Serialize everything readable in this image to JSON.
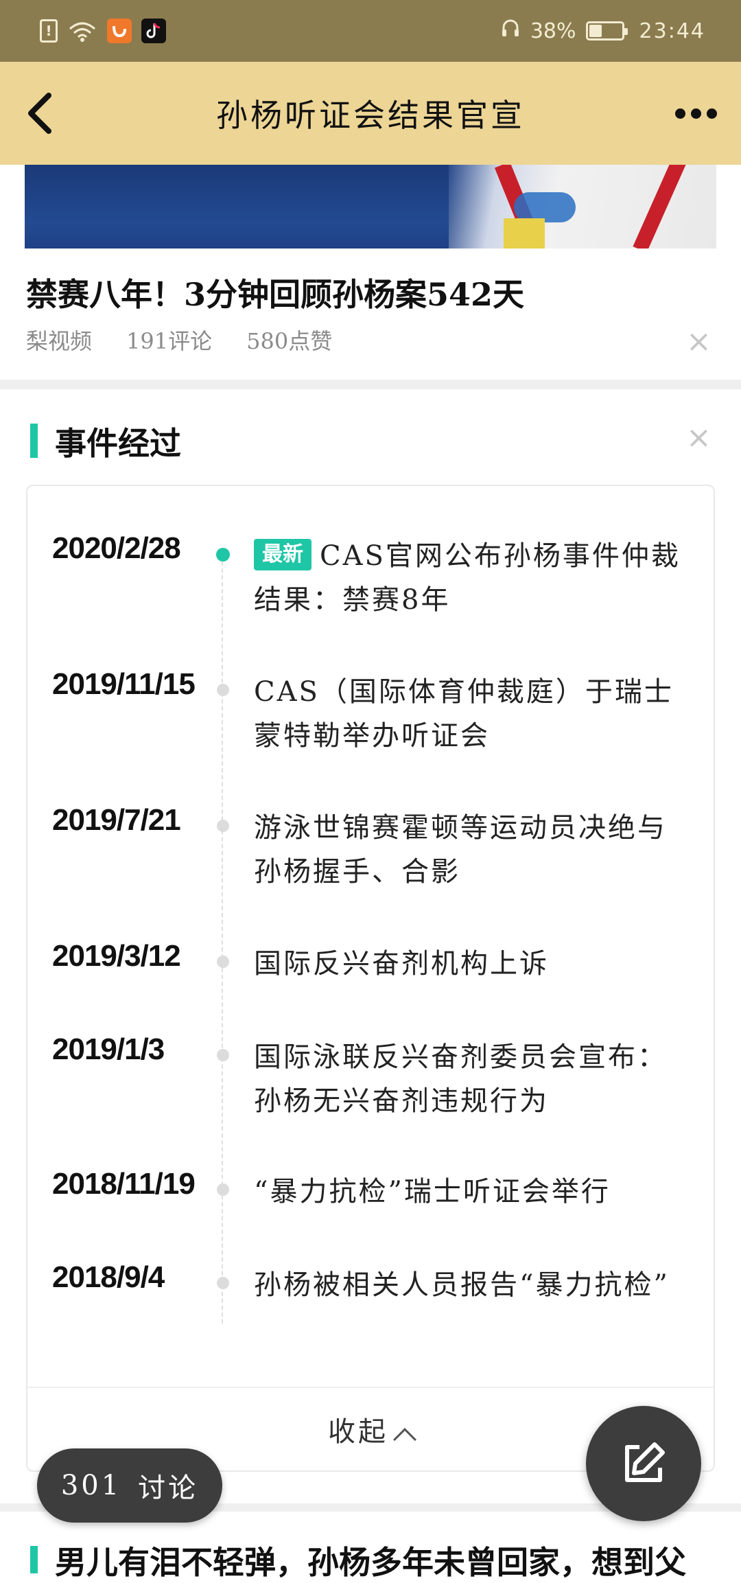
{
  "status_bar": {
    "battery_text": "38%",
    "battery_level": 0.38,
    "time": "23:44",
    "icons": [
      "alert-icon",
      "wifi-icon",
      "uc-browser-icon",
      "tiktok-icon",
      "headphones-icon",
      "battery-icon"
    ],
    "background": "#8a7c4f"
  },
  "header": {
    "title": "孙杨听证会结果官宣",
    "background": "#ecd595"
  },
  "video_card": {
    "title": "禁赛八年！3分钟回顾孙杨案542天",
    "source": "梨视频",
    "comments": "191评论",
    "likes": "580点赞"
  },
  "timeline": {
    "section_title": "事件经过",
    "accent": "#1fc6a6",
    "badge": "最新",
    "events": [
      {
        "date": "2020/2/28",
        "text": "CAS官网公布孙杨事件仲裁结果：禁赛8年"
      },
      {
        "date": "2019/11/15",
        "text": "CAS（国际体育仲裁庭）于瑞士蒙特勒举办听证会"
      },
      {
        "date": "2019/7/21",
        "text": "游泳世锦赛霍顿等运动员决绝与孙杨握手、合影"
      },
      {
        "date": "2019/3/12",
        "text": "国际反兴奋剂机构上诉"
      },
      {
        "date": "2019/1/3",
        "text": "国际泳联反兴奋剂委员会宣布：孙杨无兴奋剂违规行为"
      },
      {
        "date": "2018/11/19",
        "text": "“暴力抗检”瑞士听证会举行"
      },
      {
        "date": "2018/9/4",
        "text": "孙杨被相关人员报告“暴力抗检”"
      }
    ],
    "collapse_label": "收起"
  },
  "floating": {
    "discussion_count": "301",
    "discussion_label": "讨论"
  },
  "next_section": {
    "title": "男儿有泪不轻弹，孙杨多年未曾回家，想到父"
  }
}
